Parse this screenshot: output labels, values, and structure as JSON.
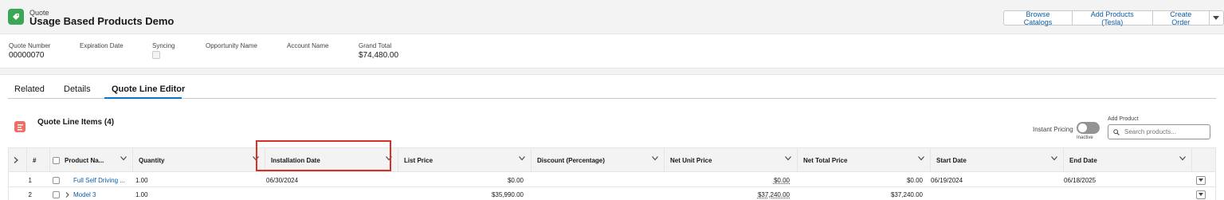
{
  "header": {
    "object_type": "Quote",
    "record_title": "Usage Based Products Demo",
    "actions": [
      "Browse Catalogs",
      "Add Products (Tesla)",
      "Create Order"
    ]
  },
  "fields": [
    {
      "label": "Quote Number",
      "value": "00000070"
    },
    {
      "label": "Expiration Date",
      "value": ""
    },
    {
      "label": "Syncing",
      "value": ""
    },
    {
      "label": "Opportunity Name",
      "value": ""
    },
    {
      "label": "Account Name",
      "value": ""
    },
    {
      "label": "Grand Total",
      "value": "$74,480.00"
    }
  ],
  "tabs": [
    "Related",
    "Details",
    "Quote Line Editor"
  ],
  "active_tab": "Quote Line Editor",
  "quote_lines": {
    "title": "Quote Line Items (4)",
    "instant_pricing_label": "Instant Pricing",
    "instant_pricing_state": "Inactive",
    "add_product_label": "Add Product",
    "search_placeholder": "Search products...",
    "columns": [
      "#",
      "Product Na...",
      "Quantity",
      "Installation Date",
      "List Price",
      "Discount (Percentage)",
      "Net Unit Price",
      "Net Total Price",
      "Start Date",
      "End Date"
    ],
    "rows": [
      {
        "num": "1",
        "product": "Full Self Driving ...",
        "quantity": "1.00",
        "installation_date": "06/30/2024",
        "list_price": "$0.00",
        "discount": "",
        "net_unit_price": "$0.00",
        "net_total_price": "$0.00",
        "start_date": "06/19/2024",
        "end_date": "06/18/2025"
      },
      {
        "num": "2",
        "product": "Model 3",
        "quantity": "1.00",
        "installation_date": "",
        "list_price": "$35,990.00",
        "discount": "",
        "net_unit_price": "$37,240.00",
        "net_total_price": "$37,240.00",
        "start_date": "",
        "end_date": ""
      }
    ]
  },
  "colors": {
    "brand": "#0176d3",
    "link": "#0b5cab",
    "quote_icon": "#3ba755",
    "quote_lines_icon": "#ef6e64",
    "highlight": "#d93025"
  }
}
